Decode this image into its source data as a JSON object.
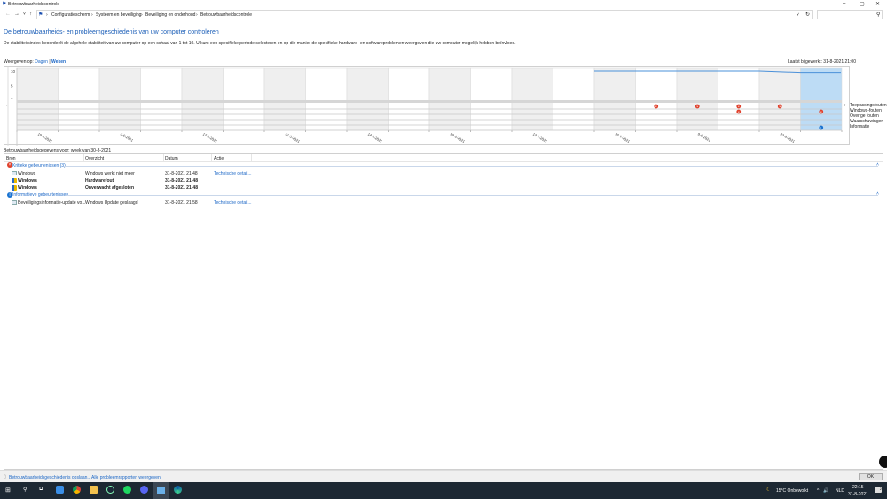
{
  "window": {
    "title": "Betrouwbaarheidscontrole",
    "minimize": "–",
    "maximize": "▢",
    "close": "✕"
  },
  "nav": {
    "back": "←",
    "forward": "→",
    "recent": "˅",
    "up": "↑",
    "breadcrumb": [
      "Configuratiescherm",
      "Systeem en beveiliging",
      "Beveiliging en onderhoud",
      "Betrouwbaarheidscontrole"
    ],
    "separator": "›",
    "dropdown": "˅",
    "refresh": "↻",
    "search_placeholder": "",
    "search_icon": "⚲"
  },
  "main": {
    "heading": "De betrouwbaarheids- en probleemgeschiedenis van uw computer controleren",
    "description": "De stabiliteitsindex beoordeelt de algehele stabiliteit van uw computer op een schaal van 1 tot 10. U kunt een specifieke periode selecteren en op die manier de specifieke hardware- en softwareproblemen weergeven die uw computer mogelijk hebben beïnvloed.",
    "view_label": "Weergeven op:",
    "view_days": "Dagen",
    "view_sep": "|",
    "view_weeks": "Weken",
    "last_updated": "Laatst bijgewerkt: 31-8-2021 21:00",
    "details_title": "Betrouwbaarheidsgegevens voor: week van 30-8-2021"
  },
  "chart_data": {
    "type": "timeline",
    "y_ticks": [
      "10",
      "5",
      "1"
    ],
    "ylim": [
      1,
      10
    ],
    "x_labels": [
      "19-4-2021",
      "3-5-2021",
      "17-5-2021",
      "31-5-2021",
      "14-6-2021",
      "28-6-2021",
      "12-7-2021",
      "26-7-2021",
      "9-8-2021",
      "23-8-2021"
    ],
    "weeks": 20,
    "selected_week": 19,
    "stability_index": [
      null,
      null,
      null,
      null,
      null,
      null,
      null,
      null,
      null,
      null,
      null,
      null,
      null,
      null,
      10,
      10,
      10,
      10,
      10,
      9.5
    ],
    "event_rows": [
      "Toepassingsfouten",
      "Windows-fouten",
      "Overige fouten",
      "Waarschuwingen",
      "Informatie"
    ],
    "events": [
      {
        "row": 0,
        "week": 15,
        "kind": "error"
      },
      {
        "row": 0,
        "week": 16,
        "kind": "error"
      },
      {
        "row": 0,
        "week": 17,
        "kind": "error"
      },
      {
        "row": 0,
        "week": 18,
        "kind": "error"
      },
      {
        "row": 1,
        "week": 17,
        "kind": "error"
      },
      {
        "row": 1,
        "week": 19,
        "kind": "error"
      },
      {
        "row": 4,
        "week": 19,
        "kind": "info"
      }
    ],
    "colors": {
      "stability": "#4a90d9",
      "selected": "#bddcf5",
      "shade": "#efefef",
      "error": "#e0412c",
      "info": "#1a73d1"
    }
  },
  "table": {
    "headers": [
      "Bron",
      "Overzicht",
      "Datum",
      "Actie"
    ],
    "groups": [
      {
        "title": "Kritieke gebeurtenissen (3)",
        "icon": "error",
        "rows": [
          {
            "source": "Windows",
            "summary": "Windows werkt niet meer",
            "date": "31-8-2021 21:48",
            "action": "Technische detail...",
            "bold": false
          },
          {
            "source": "Windows",
            "summary": "Hardwarefout",
            "date": "31-8-2021 21:48",
            "action": "",
            "bold": true
          },
          {
            "source": "Windows",
            "summary": "Onverwacht afgesloten",
            "date": "31-8-2021 21:48",
            "action": "",
            "bold": true
          }
        ]
      },
      {
        "title": "Informatieve gebeurtenissen",
        "icon": "info",
        "rows": [
          {
            "source": "Beveiligingsinformatie-update vo...",
            "summary": "Windows Update geslaagd",
            "date": "31-8-2021 21:58",
            "action": "Technische detail...",
            "bold": false
          }
        ]
      }
    ]
  },
  "footer": {
    "save_history": "Betrouwbaarheidsgeschiedenis opslaan...",
    "all_reports": "Alle probleemrapporten weergeven",
    "ok": "OK"
  },
  "taskbar": {
    "weather": "15°C  Onbewolkt",
    "tray_arrow": "^",
    "volume": "🔊",
    "lang": "NLD",
    "time": "22:15",
    "date": "31-8-2021",
    "notification_count": "2"
  }
}
